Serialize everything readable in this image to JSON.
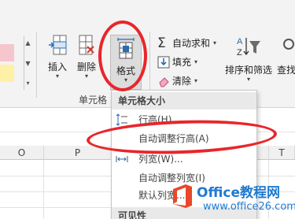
{
  "ribbon": {
    "buttons": {
      "insert_label": "插入",
      "delete_label": "删除",
      "format_label": "格式",
      "sort_filter_label": "排序和筛选",
      "find_label": "查找"
    },
    "editing": {
      "autosum_label": "自动求和",
      "fill_label": "填充",
      "clear_label": "清除"
    },
    "group_label_cells": "单元格"
  },
  "sheet": {
    "columns": [
      "O",
      "P",
      "T"
    ]
  },
  "menu": {
    "section_cell_size": "单元格大小",
    "items": [
      {
        "label": "行高(H)..."
      },
      {
        "label": "自动调整行高(A)"
      },
      {
        "label": "列宽(W)..."
      },
      {
        "label": "自动调整列宽(I)"
      },
      {
        "label": "默认列宽..."
      }
    ],
    "section_visibility": "可见性"
  },
  "watermark": {
    "title": "Office教程网",
    "url": "www.office26.com"
  },
  "colors": {
    "annotation_red": "#e8262b",
    "accent_blue": "#1f7ad0",
    "swatch_pink": "#f6c6cf",
    "swatch_yellow": "#fff0a8"
  }
}
